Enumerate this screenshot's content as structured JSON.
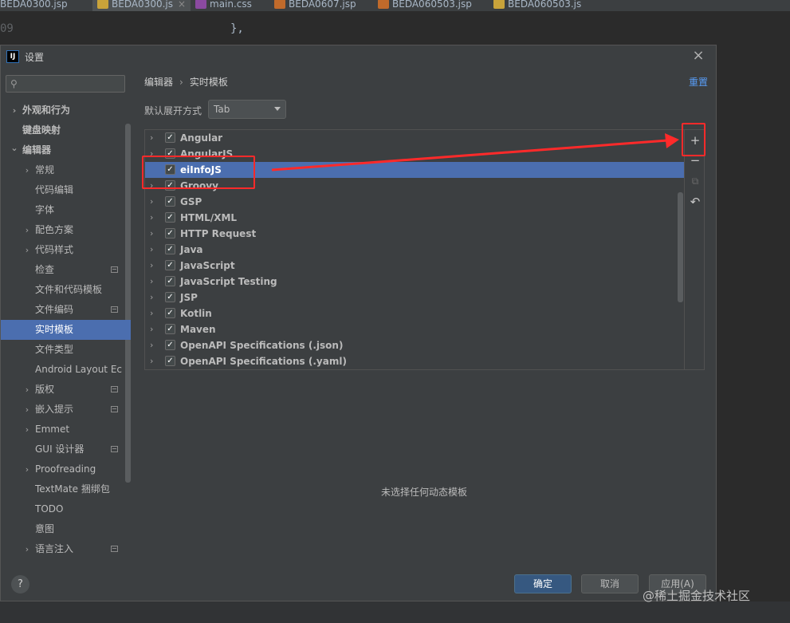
{
  "editor": {
    "tabs": [
      "BEDA0300.jsp",
      "BEDA0300.js",
      "main.css",
      "BEDA0607.jsp",
      "BEDA060503.jsp",
      "BEDA060503.js"
    ],
    "line_number": "09",
    "code_text": "},",
    "tab_close": "×"
  },
  "dialog": {
    "title": "设置",
    "app_icon": "IJ",
    "close": "×"
  },
  "sidebar": {
    "search_placeholder": "",
    "items": [
      {
        "label": "外观和行为",
        "chev": "›"
      },
      {
        "label": "键盘映射",
        "chev": ""
      },
      {
        "label": "编辑器",
        "chev": "⌄"
      },
      {
        "label": "常规",
        "chev": "›"
      },
      {
        "label": "代码编辑",
        "chev": ""
      },
      {
        "label": "字体",
        "chev": ""
      },
      {
        "label": "配色方案",
        "chev": "›"
      },
      {
        "label": "代码样式",
        "chev": "›"
      },
      {
        "label": "检查",
        "chev": ""
      },
      {
        "label": "文件和代码模板",
        "chev": ""
      },
      {
        "label": "文件编码",
        "chev": ""
      },
      {
        "label": "实时模板",
        "chev": ""
      },
      {
        "label": "文件类型",
        "chev": ""
      },
      {
        "label": "Android Layout Ec",
        "chev": ""
      },
      {
        "label": "版权",
        "chev": "›"
      },
      {
        "label": "嵌入提示",
        "chev": "›"
      },
      {
        "label": "Emmet",
        "chev": "›"
      },
      {
        "label": "GUI 设计器",
        "chev": ""
      },
      {
        "label": "Proofreading",
        "chev": "›"
      },
      {
        "label": "TextMate 捆绑包",
        "chev": ""
      },
      {
        "label": "TODO",
        "chev": ""
      },
      {
        "label": "意图",
        "chev": ""
      },
      {
        "label": "语言注入",
        "chev": "›"
      },
      {
        "label": "",
        "chev": ""
      }
    ]
  },
  "main": {
    "breadcrumb": [
      "编辑器",
      "实时模板"
    ],
    "breadcrumb_sep": "›",
    "reset": "重置",
    "expand_label": "默认展开方式",
    "expand_value": "Tab",
    "templates": [
      {
        "label": "Angular",
        "checked": "✓"
      },
      {
        "label": "AngularJS",
        "checked": "✓"
      },
      {
        "label": "eiInfoJS",
        "checked": "✓"
      },
      {
        "label": "Groovy",
        "checked": "✓"
      },
      {
        "label": "GSP",
        "checked": "✓"
      },
      {
        "label": "HTML/XML",
        "checked": "✓"
      },
      {
        "label": "HTTP Request",
        "checked": "✓"
      },
      {
        "label": "Java",
        "checked": "✓"
      },
      {
        "label": "JavaScript",
        "checked": "✓"
      },
      {
        "label": "JavaScript Testing",
        "checked": "✓"
      },
      {
        "label": "JSP",
        "checked": "✓"
      },
      {
        "label": "Kotlin",
        "checked": "✓"
      },
      {
        "label": "Maven",
        "checked": "✓"
      },
      {
        "label": "OpenAPI Specifications (.json)",
        "checked": "✓"
      },
      {
        "label": "OpenAPI Specifications (.yaml)",
        "checked": "✓"
      }
    ],
    "row_chev": "›",
    "toolbar": {
      "add": "+",
      "remove": "−",
      "copy": "⧉",
      "restore": "↶"
    },
    "empty_message": "未选择任何动态模板"
  },
  "footer": {
    "help": "?",
    "ok": "确定",
    "cancel": "取消",
    "apply": "应用(A)"
  },
  "annotation_color": "#ff2a2a",
  "selection_color": "#4b6eaf",
  "watermark": "@稀土掘金技术社区"
}
